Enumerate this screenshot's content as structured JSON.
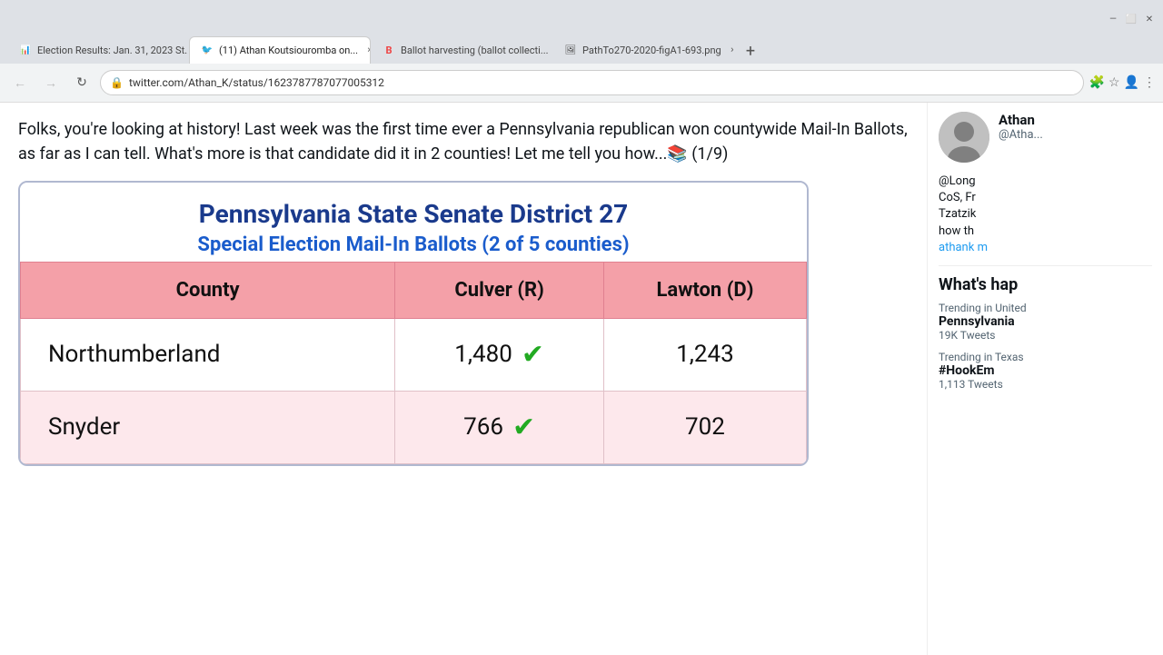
{
  "browser": {
    "tabs": [
      {
        "id": "tab1",
        "favicon": "📊",
        "label": "Election Results: Jan. 31, 2023 St...",
        "active": false,
        "closeable": true
      },
      {
        "id": "tab2",
        "favicon": "🐦",
        "label": "(11) Athan Koutsiouromba on...",
        "active": true,
        "closeable": true
      },
      {
        "id": "tab3",
        "favicon": "B",
        "label": "Ballot harvesting (ballot collecti...",
        "active": false,
        "closeable": true
      },
      {
        "id": "tab4",
        "favicon": "🖼",
        "label": "PathTo270-2020-figA1-693.png",
        "active": false,
        "closeable": true
      }
    ],
    "url": "twitter.com/Athan_K/status/1623787787077005312",
    "nav": {
      "back_disabled": false,
      "forward_disabled": false
    }
  },
  "tweet": {
    "text_part1": "Folks, you're looking at history!  Last week was the first time ever a Pennsylvania republican won countywide Mail-In Ballots, as far as I can tell.  What's more is that candidate did it in 2 counties!  Let me tell you how...📚 (1/9)"
  },
  "table": {
    "title1": "Pennsylvania State Senate District 27",
    "title2": "Special Election Mail-In Ballots (2 of 5 counties)",
    "headers": [
      "County",
      "Culver (R)",
      "Lawton (D)"
    ],
    "rows": [
      {
        "county": "Northumberland",
        "culver": "1,480",
        "culver_win": true,
        "lawton": "1,243"
      },
      {
        "county": "Snyder",
        "culver": "766",
        "culver_win": true,
        "lawton": "702"
      }
    ]
  },
  "sidebar": {
    "profile": {
      "name": "Athan",
      "handle": "@Atha...",
      "bio_line1": "@Long",
      "bio_line2": "CoS, Fr",
      "bio_line3": "Tzatzik",
      "bio_line4": "how th",
      "link_text": "athank",
      "link_text2": "m"
    },
    "whats_happening": {
      "title": "What's hap",
      "trends": [
        {
          "context": "Trending in United",
          "name": "Pennsylvania",
          "count": "19K Tweets"
        },
        {
          "context": "Trending in Texas",
          "name": "#HookEm",
          "count": "1,113 Tweets"
        }
      ]
    }
  },
  "icons": {
    "back": "←",
    "forward": "→",
    "reload": "↻",
    "lock": "🔒",
    "star": "☆",
    "extensions": "🧩",
    "profile": "👤",
    "menu": "⋮",
    "new_tab": "+",
    "checkmark": "✓",
    "tab_close": "×",
    "bookmark": "⊹",
    "share": "⊗"
  }
}
